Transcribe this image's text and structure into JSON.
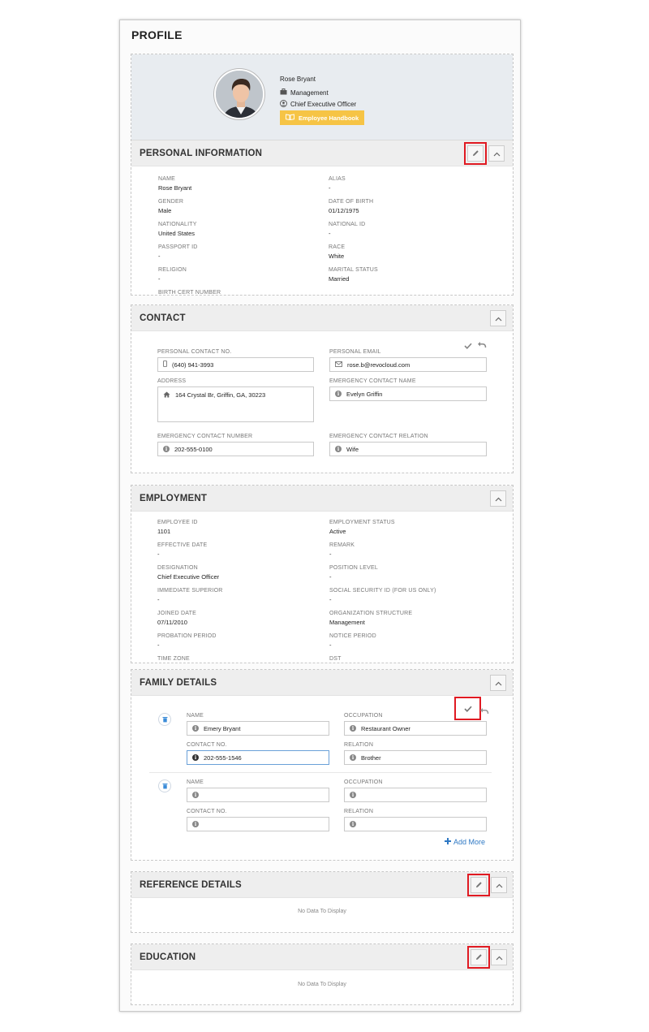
{
  "page_title": "PROFILE",
  "profile": {
    "name": "Rose Bryant",
    "department": "Management",
    "designation": "Chief Executive Officer",
    "handbook_label": "Employee Handbook"
  },
  "personal": {
    "title": "PERSONAL INFORMATION",
    "fields": [
      {
        "label": "NAME",
        "value": "Rose Bryant"
      },
      {
        "label": "ALIAS",
        "value": "-"
      },
      {
        "label": "GENDER",
        "value": "Male"
      },
      {
        "label": "DATE OF BIRTH",
        "value": "01/12/1975"
      },
      {
        "label": "NATIONALITY",
        "value": "United States"
      },
      {
        "label": "NATIONAL ID",
        "value": "-"
      },
      {
        "label": "PASSPORT ID",
        "value": "-"
      },
      {
        "label": "RACE",
        "value": "White"
      },
      {
        "label": "RELIGION",
        "value": "-"
      },
      {
        "label": "MARITAL STATUS",
        "value": "Married"
      },
      {
        "label": "BIRTH CERT NUMBER",
        "value": ""
      }
    ]
  },
  "contact": {
    "title": "CONTACT",
    "personal_contact_label": "PERSONAL CONTACT NO.",
    "personal_contact_value": "(640) 941-3993",
    "personal_email_label": "PERSONAL EMAIL",
    "personal_email_value": "rose.b@revocloud.com",
    "address_label": "ADDRESS",
    "address_value": "164 Crystal Br, Griffin, GA, 30223",
    "emergency_name_label": "EMERGENCY CONTACT NAME",
    "emergency_name_value": "Evelyn Griffin",
    "emergency_number_label": "EMERGENCY CONTACT NUMBER",
    "emergency_number_value": "202-555-0100",
    "emergency_relation_label": "EMERGENCY CONTACT RELATION",
    "emergency_relation_value": "Wife"
  },
  "employment": {
    "title": "EMPLOYMENT",
    "fields": [
      {
        "label": "EMPLOYEE ID",
        "value": "1101"
      },
      {
        "label": "EMPLOYMENT STATUS",
        "value": "Active"
      },
      {
        "label": "EFFECTIVE DATE",
        "value": "-"
      },
      {
        "label": "REMARK",
        "value": "-"
      },
      {
        "label": "DESIGNATION",
        "value": "Chief Executive Officer"
      },
      {
        "label": "POSITION LEVEL",
        "value": "-"
      },
      {
        "label": "IMMEDIATE SUPERIOR",
        "value": "-"
      },
      {
        "label": "SOCIAL SECURITY ID (FOR US ONLY)",
        "value": "-"
      },
      {
        "label": "JOINED DATE",
        "value": "07/11/2010"
      },
      {
        "label": "ORGANIZATION STRUCTURE",
        "value": "Management"
      },
      {
        "label": "PROBATION PERIOD",
        "value": "-"
      },
      {
        "label": "NOTICE PERIOD",
        "value": "-"
      },
      {
        "label": "TIME ZONE",
        "value": ""
      },
      {
        "label": "DST",
        "value": ""
      }
    ]
  },
  "family": {
    "title": "FAMILY DETAILS",
    "name_label": "NAME",
    "occupation_label": "OCCUPATION",
    "contact_label": "CONTACT NO.",
    "relation_label": "RELATION",
    "members": [
      {
        "name": "Emery Bryant",
        "occupation": "Restaurant Owner",
        "contact": "202-555-1546",
        "relation": "Brother"
      },
      {
        "name": "",
        "occupation": "",
        "contact": "",
        "relation": ""
      }
    ],
    "add_more_label": "Add More"
  },
  "reference": {
    "title": "REFERENCE DETAILS",
    "empty_message": "No Data To Display"
  },
  "education": {
    "title": "EDUCATION",
    "empty_message": "No Data To Display"
  },
  "colors": {
    "highlight": "#e01a22",
    "handbook": "#f6c445",
    "link": "#2e78c4",
    "header_bg": "#eeeeee"
  },
  "icons": {
    "edit": "pencil-icon",
    "collapse": "chevron-up-icon",
    "save": "check-icon",
    "undo": "undo-icon",
    "delete": "trash-icon",
    "phone": "mobile-icon",
    "email": "envelope-icon",
    "address": "home-icon",
    "info": "info-icon"
  }
}
